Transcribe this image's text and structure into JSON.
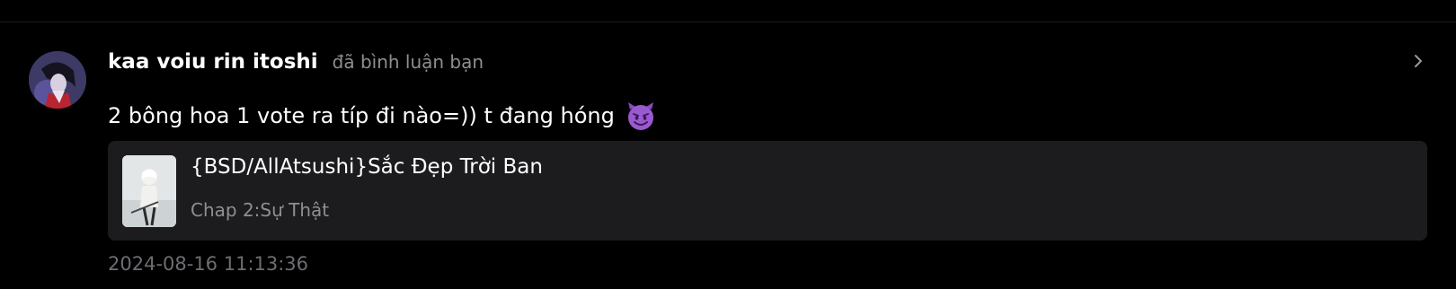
{
  "notification": {
    "username": "kaa voiu rin itoshi",
    "action": "đã bình luận bạn",
    "comment_text": "2 bông hoa 1 vote ra típ đi nào=)) t đang hóng",
    "emoji": "smiling-imp",
    "timestamp": "2024-08-16 11:13:36"
  },
  "story": {
    "title": "{BSD/AllAtsushi}Sắc Đẹp Trời Ban",
    "chapter": "Chap 2:Sự Thật"
  },
  "colors": {
    "background": "#000000",
    "card": "#1c1c1e",
    "primary_text": "#ffffff",
    "secondary_text": "#8e8e93",
    "emoji_purple": "#9b59d0"
  },
  "icons": {
    "chevron": "chevron-right-icon"
  }
}
